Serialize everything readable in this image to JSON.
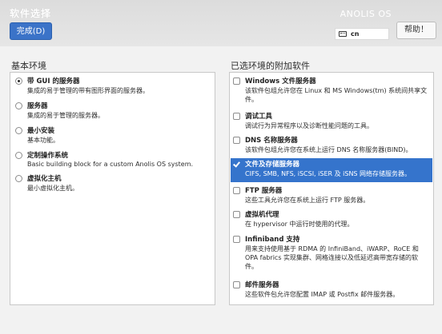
{
  "header": {
    "title": "软件选择",
    "product": "ANOLIS OS",
    "done_label": "完成(D)",
    "keyboard_layout": "cn",
    "help_label": "帮助！"
  },
  "left": {
    "heading": "基本环境",
    "options": [
      {
        "title": "带 GUI 的服务器",
        "desc": "集成的易于管理的带有图形界面的服务器。",
        "selected": true
      },
      {
        "title": "服务器",
        "desc": "集成的易于管理的服务器。",
        "selected": false
      },
      {
        "title": "最小安装",
        "desc": "基本功能。",
        "selected": false
      },
      {
        "title": "定制操作系统",
        "desc": "Basic building block for a custom Anolis OS system.",
        "selected": false
      },
      {
        "title": "虚拟化主机",
        "desc": "最小虚拟化主机。",
        "selected": false
      }
    ]
  },
  "right": {
    "heading": "已选环境的附加软件",
    "addons": [
      {
        "title": "Windows 文件服务器",
        "desc": "该软件包组允许您在 Linux 和 MS Windows(tm) 系统间共享文件。",
        "checked": false
      },
      {
        "title": "调试工具",
        "desc": "调试行为异常程序以及诊断性能问题的工具。",
        "checked": false
      },
      {
        "title": "DNS 名称服务器",
        "desc": "该软件包组允许您在系统上运行 DNS 名称服务器(BIND)。",
        "checked": false
      },
      {
        "title": "文件及存储服务器",
        "desc": "CIFS, SMB, NFS, iSCSI, iSER 及 iSNS 网络存储服务器。",
        "checked": true
      },
      {
        "title": "FTP 服务器",
        "desc": "这些工具允许您在系统上运行 FTP 服务器。",
        "checked": false
      },
      {
        "title": "虚拟机代理",
        "desc": "在 hypervisor 中运行时使用的代理。",
        "checked": false
      },
      {
        "title": "Infiniband 支持",
        "desc": "用来支持使用基于 RDMA 的 InfiniBand、iWARP、RoCE 和 OPA fabrics 实现集群、网格连接以及低延迟高带宽存储的软件。",
        "checked": false
      },
      {
        "title": "邮件服务器",
        "desc": "这些软件包允许您配置 IMAP 或 Postfix 邮件服务器。",
        "checked": false
      }
    ]
  },
  "colors": {
    "accent": "#3574cc",
    "done_button": "#3b73c8"
  }
}
